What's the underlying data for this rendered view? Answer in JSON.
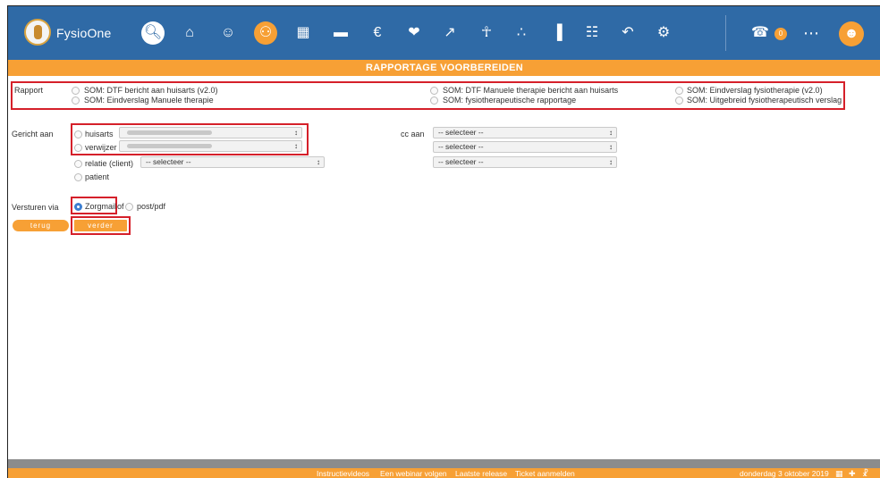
{
  "app": {
    "brand": "FysioOne"
  },
  "nav": {
    "icons": [
      "search-icon",
      "home-icon",
      "user-icon",
      "group-icon",
      "calendar-icon",
      "folder-icon",
      "finance-icon",
      "handshake-icon",
      "activity-icon",
      "body-icon",
      "hierarchy-icon",
      "chart-icon",
      "book-icon",
      "back-icon",
      "settings-icon"
    ],
    "notification_count": "0"
  },
  "page": {
    "title": "RAPPORTAGE VOORBEREIDEN"
  },
  "rapport": {
    "label": "Rapport",
    "options": [
      "SOM: DTF bericht aan huisarts (v2.0)",
      "SOM: Eindverslag Manuele therapie",
      "SOM: DTF Manuele therapie bericht aan huisarts",
      "SOM: fysiotherapeutische rapportage",
      "SOM: Eindverslag fysiotherapie (v2.0)",
      "SOM: Uitgebreid fysiotherapeutisch verslag"
    ]
  },
  "gericht": {
    "label": "Gericht aan",
    "huisarts": "huisarts",
    "verwijzer": "verwijzer",
    "relatie": "relatie (client)",
    "patient": "patient",
    "relatie_select": "-- selecteer --"
  },
  "cc": {
    "label": "cc aan",
    "selects": [
      "-- selecteer --",
      "-- selecteer --",
      "-- selecteer --"
    ]
  },
  "versturen": {
    "label": "Versturen via",
    "zorgmail": "Zorgmail",
    "of": "of",
    "postpdf": "post/pdf"
  },
  "buttons": {
    "terug": "terug",
    "verder": "verder"
  },
  "footer": {
    "links": [
      "Instructievideos",
      "Een webinar volgen",
      "Laatste release",
      "Ticket aanmelden"
    ],
    "date": "donderdag 3 oktober 2019"
  },
  "colors": {
    "nav_blue": "#2f6aa6",
    "accent_orange": "#f7a035",
    "highlight_red": "#d5202a"
  }
}
